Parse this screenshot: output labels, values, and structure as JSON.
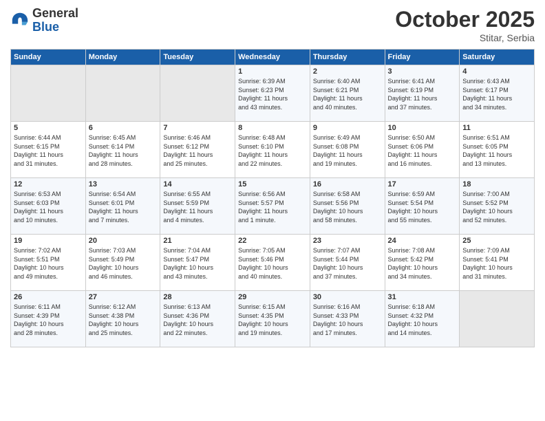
{
  "logo": {
    "general": "General",
    "blue": "Blue"
  },
  "title": "October 2025",
  "subtitle": "Stitar, Serbia",
  "days_of_week": [
    "Sunday",
    "Monday",
    "Tuesday",
    "Wednesday",
    "Thursday",
    "Friday",
    "Saturday"
  ],
  "weeks": [
    [
      {
        "day": "",
        "info": ""
      },
      {
        "day": "",
        "info": ""
      },
      {
        "day": "",
        "info": ""
      },
      {
        "day": "1",
        "info": "Sunrise: 6:39 AM\nSunset: 6:23 PM\nDaylight: 11 hours\nand 43 minutes."
      },
      {
        "day": "2",
        "info": "Sunrise: 6:40 AM\nSunset: 6:21 PM\nDaylight: 11 hours\nand 40 minutes."
      },
      {
        "day": "3",
        "info": "Sunrise: 6:41 AM\nSunset: 6:19 PM\nDaylight: 11 hours\nand 37 minutes."
      },
      {
        "day": "4",
        "info": "Sunrise: 6:43 AM\nSunset: 6:17 PM\nDaylight: 11 hours\nand 34 minutes."
      }
    ],
    [
      {
        "day": "5",
        "info": "Sunrise: 6:44 AM\nSunset: 6:15 PM\nDaylight: 11 hours\nand 31 minutes."
      },
      {
        "day": "6",
        "info": "Sunrise: 6:45 AM\nSunset: 6:14 PM\nDaylight: 11 hours\nand 28 minutes."
      },
      {
        "day": "7",
        "info": "Sunrise: 6:46 AM\nSunset: 6:12 PM\nDaylight: 11 hours\nand 25 minutes."
      },
      {
        "day": "8",
        "info": "Sunrise: 6:48 AM\nSunset: 6:10 PM\nDaylight: 11 hours\nand 22 minutes."
      },
      {
        "day": "9",
        "info": "Sunrise: 6:49 AM\nSunset: 6:08 PM\nDaylight: 11 hours\nand 19 minutes."
      },
      {
        "day": "10",
        "info": "Sunrise: 6:50 AM\nSunset: 6:06 PM\nDaylight: 11 hours\nand 16 minutes."
      },
      {
        "day": "11",
        "info": "Sunrise: 6:51 AM\nSunset: 6:05 PM\nDaylight: 11 hours\nand 13 minutes."
      }
    ],
    [
      {
        "day": "12",
        "info": "Sunrise: 6:53 AM\nSunset: 6:03 PM\nDaylight: 11 hours\nand 10 minutes."
      },
      {
        "day": "13",
        "info": "Sunrise: 6:54 AM\nSunset: 6:01 PM\nDaylight: 11 hours\nand 7 minutes."
      },
      {
        "day": "14",
        "info": "Sunrise: 6:55 AM\nSunset: 5:59 PM\nDaylight: 11 hours\nand 4 minutes."
      },
      {
        "day": "15",
        "info": "Sunrise: 6:56 AM\nSunset: 5:57 PM\nDaylight: 11 hours\nand 1 minute."
      },
      {
        "day": "16",
        "info": "Sunrise: 6:58 AM\nSunset: 5:56 PM\nDaylight: 10 hours\nand 58 minutes."
      },
      {
        "day": "17",
        "info": "Sunrise: 6:59 AM\nSunset: 5:54 PM\nDaylight: 10 hours\nand 55 minutes."
      },
      {
        "day": "18",
        "info": "Sunrise: 7:00 AM\nSunset: 5:52 PM\nDaylight: 10 hours\nand 52 minutes."
      }
    ],
    [
      {
        "day": "19",
        "info": "Sunrise: 7:02 AM\nSunset: 5:51 PM\nDaylight: 10 hours\nand 49 minutes."
      },
      {
        "day": "20",
        "info": "Sunrise: 7:03 AM\nSunset: 5:49 PM\nDaylight: 10 hours\nand 46 minutes."
      },
      {
        "day": "21",
        "info": "Sunrise: 7:04 AM\nSunset: 5:47 PM\nDaylight: 10 hours\nand 43 minutes."
      },
      {
        "day": "22",
        "info": "Sunrise: 7:05 AM\nSunset: 5:46 PM\nDaylight: 10 hours\nand 40 minutes."
      },
      {
        "day": "23",
        "info": "Sunrise: 7:07 AM\nSunset: 5:44 PM\nDaylight: 10 hours\nand 37 minutes."
      },
      {
        "day": "24",
        "info": "Sunrise: 7:08 AM\nSunset: 5:42 PM\nDaylight: 10 hours\nand 34 minutes."
      },
      {
        "day": "25",
        "info": "Sunrise: 7:09 AM\nSunset: 5:41 PM\nDaylight: 10 hours\nand 31 minutes."
      }
    ],
    [
      {
        "day": "26",
        "info": "Sunrise: 6:11 AM\nSunset: 4:39 PM\nDaylight: 10 hours\nand 28 minutes."
      },
      {
        "day": "27",
        "info": "Sunrise: 6:12 AM\nSunset: 4:38 PM\nDaylight: 10 hours\nand 25 minutes."
      },
      {
        "day": "28",
        "info": "Sunrise: 6:13 AM\nSunset: 4:36 PM\nDaylight: 10 hours\nand 22 minutes."
      },
      {
        "day": "29",
        "info": "Sunrise: 6:15 AM\nSunset: 4:35 PM\nDaylight: 10 hours\nand 19 minutes."
      },
      {
        "day": "30",
        "info": "Sunrise: 6:16 AM\nSunset: 4:33 PM\nDaylight: 10 hours\nand 17 minutes."
      },
      {
        "day": "31",
        "info": "Sunrise: 6:18 AM\nSunset: 4:32 PM\nDaylight: 10 hours\nand 14 minutes."
      },
      {
        "day": "",
        "info": ""
      }
    ]
  ]
}
